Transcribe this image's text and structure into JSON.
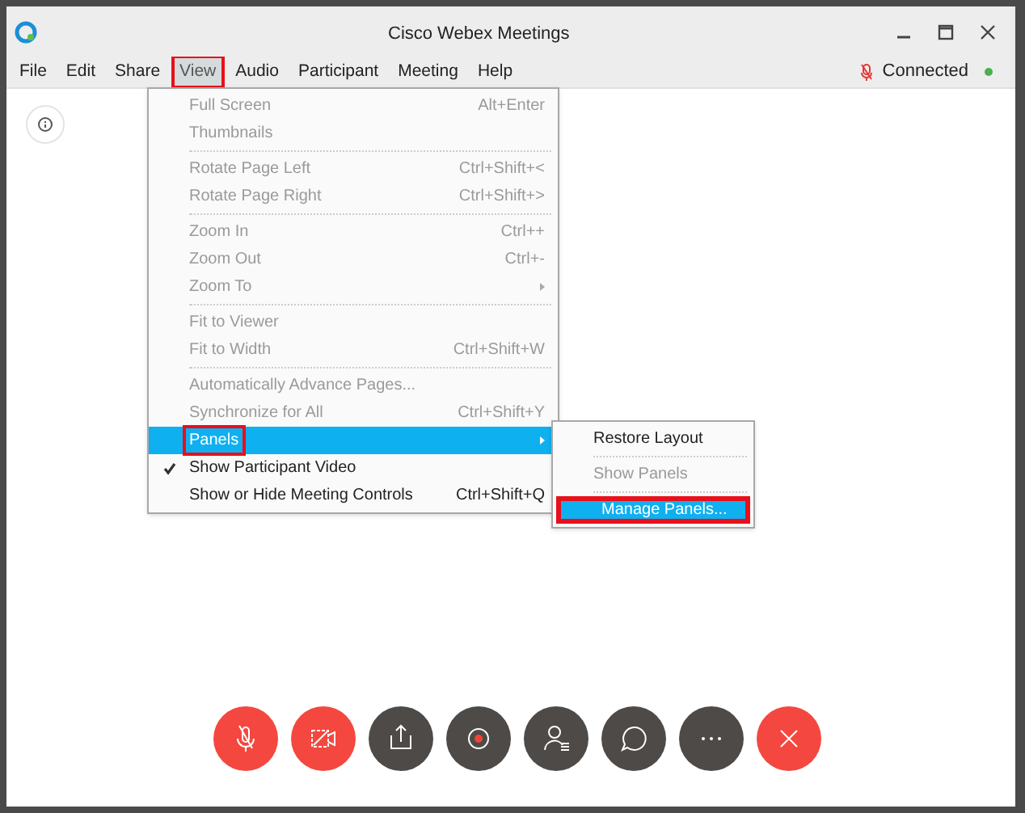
{
  "window": {
    "title": "Cisco Webex Meetings"
  },
  "menu_bar": [
    {
      "label": "File",
      "selected": false,
      "annotated": false
    },
    {
      "label": "Edit",
      "selected": false,
      "annotated": false
    },
    {
      "label": "Share",
      "selected": false,
      "annotated": false
    },
    {
      "label": "View",
      "selected": true,
      "annotated": true
    },
    {
      "label": "Audio",
      "selected": false,
      "annotated": false
    },
    {
      "label": "Participant",
      "selected": false,
      "annotated": false
    },
    {
      "label": "Meeting",
      "selected": false,
      "annotated": false
    },
    {
      "label": "Help",
      "selected": false,
      "annotated": false
    }
  ],
  "status": {
    "label": "Connected"
  },
  "view_menu": [
    {
      "kind": "item",
      "label": "Full Screen",
      "shortcut": "Alt+Enter",
      "disabled": true,
      "checked": false,
      "submenu": false,
      "selected": false,
      "annotated": false
    },
    {
      "kind": "item",
      "label": "Thumbnails",
      "disabled": true,
      "checked": false,
      "submenu": false,
      "selected": false,
      "annotated": false
    },
    {
      "kind": "separator"
    },
    {
      "kind": "item",
      "label": "Rotate Page Left",
      "shortcut": "Ctrl+Shift+<",
      "disabled": true,
      "checked": false,
      "submenu": false,
      "selected": false,
      "annotated": false
    },
    {
      "kind": "item",
      "label": "Rotate Page Right",
      "shortcut": "Ctrl+Shift+>",
      "disabled": true,
      "checked": false,
      "submenu": false,
      "selected": false,
      "annotated": false
    },
    {
      "kind": "separator"
    },
    {
      "kind": "item",
      "label": "Zoom In",
      "shortcut": "Ctrl++",
      "disabled": true,
      "checked": false,
      "submenu": false,
      "selected": false,
      "annotated": false
    },
    {
      "kind": "item",
      "label": "Zoom Out",
      "shortcut": "Ctrl+-",
      "disabled": true,
      "checked": false,
      "submenu": false,
      "selected": false,
      "annotated": false
    },
    {
      "kind": "item",
      "label": "Zoom To",
      "disabled": true,
      "checked": false,
      "submenu": true,
      "selected": false,
      "annotated": false
    },
    {
      "kind": "separator"
    },
    {
      "kind": "item",
      "label": "Fit to Viewer",
      "disabled": true,
      "checked": false,
      "submenu": false,
      "selected": false,
      "annotated": false
    },
    {
      "kind": "item",
      "label": "Fit to Width",
      "shortcut": "Ctrl+Shift+W",
      "disabled": true,
      "checked": false,
      "submenu": false,
      "selected": false,
      "annotated": false
    },
    {
      "kind": "separator"
    },
    {
      "kind": "item",
      "label": "Automatically Advance Pages...",
      "disabled": true,
      "checked": false,
      "submenu": false,
      "selected": false,
      "annotated": false
    },
    {
      "kind": "item",
      "label": "Synchronize for All",
      "shortcut": "Ctrl+Shift+Y",
      "disabled": true,
      "checked": false,
      "submenu": false,
      "selected": false,
      "annotated": false
    },
    {
      "kind": "item",
      "label": "Panels",
      "disabled": false,
      "checked": false,
      "submenu": true,
      "selected": true,
      "annotated": true
    },
    {
      "kind": "item",
      "label": "Show Participant Video",
      "disabled": false,
      "checked": true,
      "submenu": false,
      "selected": false,
      "annotated": false
    },
    {
      "kind": "item",
      "label": "Show or Hide Meeting Controls",
      "shortcut": "Ctrl+Shift+Q",
      "disabled": false,
      "checked": false,
      "submenu": false,
      "selected": false,
      "annotated": false
    }
  ],
  "panels_menu": [
    {
      "kind": "item",
      "label": "Restore Layout",
      "disabled": false,
      "selected": false,
      "annotated": false
    },
    {
      "kind": "separator"
    },
    {
      "kind": "item",
      "label": "Show Panels",
      "disabled": true,
      "selected": false,
      "annotated": false
    },
    {
      "kind": "separator"
    },
    {
      "kind": "item",
      "label": "Manage Panels...",
      "disabled": false,
      "selected": true,
      "annotated": true
    }
  ],
  "controls": [
    {
      "kind": "mute",
      "active": true
    },
    {
      "kind": "video",
      "active": true
    },
    {
      "kind": "share",
      "active": false
    },
    {
      "kind": "record",
      "active": false
    },
    {
      "kind": "participants",
      "active": false
    },
    {
      "kind": "chat",
      "active": false
    },
    {
      "kind": "more",
      "active": false
    },
    {
      "kind": "end",
      "active": true
    }
  ]
}
